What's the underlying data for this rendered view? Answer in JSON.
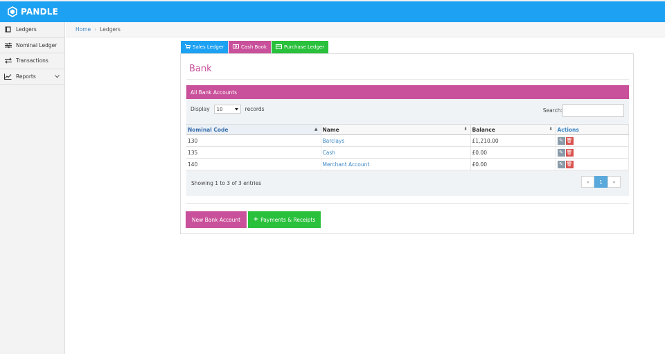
{
  "brand": {
    "name": "PANDLE"
  },
  "sidebar": {
    "items": [
      {
        "label": "Ledgers",
        "icon": "book-icon"
      },
      {
        "label": "Nominal Ledger",
        "icon": "sliders-icon"
      },
      {
        "label": "Transactions",
        "icon": "transfer-arrows-icon"
      },
      {
        "label": "Reports",
        "icon": "line-chart-icon",
        "has_chevron": true
      }
    ]
  },
  "breadcrumb": {
    "home": "Home",
    "separator": "›",
    "current": "Ledgers"
  },
  "tabs": [
    {
      "label": "Sales Ledger",
      "icon": "cart-icon",
      "color": "#1da1f2"
    },
    {
      "label": "Cash Book",
      "icon": "cash-icon",
      "color": "#c9509a"
    },
    {
      "label": "Purchase Ledger",
      "icon": "card-icon",
      "color": "#29c03b"
    }
  ],
  "page": {
    "title": "Bank"
  },
  "accounts": {
    "header": "All Bank Accounts",
    "display": {
      "label": "Display",
      "value": "10",
      "suffix": "records"
    },
    "search": {
      "label": "Search:",
      "value": "",
      "placeholder": ""
    },
    "columns": {
      "code": "Nominal Code",
      "name": "Name",
      "balance": "Balance",
      "actions": "Actions"
    },
    "rows": [
      {
        "code": "130",
        "name": "Barclays",
        "balance": "£1,210.00"
      },
      {
        "code": "135",
        "name": "Cash",
        "balance": "£0.00"
      },
      {
        "code": "140",
        "name": "Merchant Account",
        "balance": "£0.00"
      }
    ],
    "summary": "Showing 1 to 3 of 3 entries",
    "pager": {
      "prev": "«",
      "current": "1",
      "next": "»"
    }
  },
  "buttons": {
    "new_bank": "New Bank Account",
    "payments": "Payments & Receipts"
  },
  "colors": {
    "brand_blue": "#1da1f2",
    "accent_pink": "#c9509a",
    "accent_green": "#29c03b",
    "danger": "#d9534f"
  }
}
